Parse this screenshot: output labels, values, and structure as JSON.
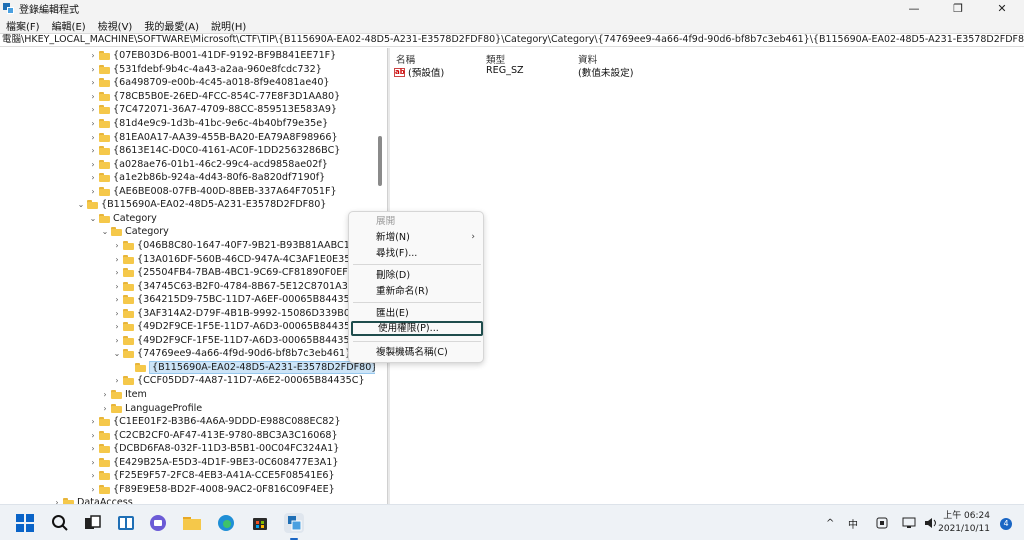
{
  "window": {
    "title": "登錄編輯程式",
    "controls": [
      "—",
      "❐",
      "✕"
    ]
  },
  "menu": [
    "檔案(F)",
    "編輯(E)",
    "檢視(V)",
    "我的最愛(A)",
    "說明(H)"
  ],
  "address": "電腦\\HKEY_LOCAL_MACHINE\\SOFTWARE\\Microsoft\\CTF\\TIP\\{B115690A-EA02-48D5-A231-E3578D2FDF80}\\Category\\Category\\{74769ee9-4a66-4f9d-90d6-bf8b7c3eb461}\\{B115690A-EA02-48D5-A231-E3578D2FDF80}",
  "tree": [
    {
      "label": "{07EB03D6-B001-41DF-9192-BF9B841EE71F}",
      "chev": "›"
    },
    {
      "label": "{531fdebf-9b4c-4a43-a2aa-960e8fcdc732}",
      "chev": "›"
    },
    {
      "label": "{6a498709-e00b-4c45-a018-8f9e4081ae40}",
      "chev": "›"
    },
    {
      "label": "{78CB5B0E-26ED-4FCC-854C-77E8F3D1AA80}",
      "chev": "›"
    },
    {
      "label": "{7C472071-36A7-4709-88CC-859513E583A9}",
      "chev": "›"
    },
    {
      "label": "{81d4e9c9-1d3b-41bc-9e6c-4b40bf79e35e}",
      "chev": "›"
    },
    {
      "label": "{81EA0A17-AA39-455B-BA20-EA79A8F98966}",
      "chev": "›"
    },
    {
      "label": "{8613E14C-D0C0-4161-AC0F-1DD2563286BC}",
      "chev": "›"
    },
    {
      "label": "{a028ae76-01b1-46c2-99c4-acd9858ae02f}",
      "chev": "›"
    },
    {
      "label": "{a1e2b86b-924a-4d43-80f6-8a820df7190f}",
      "chev": "›"
    },
    {
      "label": "{AE6BE008-07FB-400D-8BEB-337A64F7051F}",
      "chev": "›"
    },
    {
      "label": "{B115690A-EA02-48D5-A231-E3578D2FDF80}",
      "chev": "⌄"
    },
    {
      "label": "Category",
      "chev": "⌄"
    },
    {
      "label": "Category",
      "chev": "⌄"
    },
    {
      "label": "{046B8C80-1647-40F7-9B21-B93B81AABC1B}",
      "chev": "›"
    },
    {
      "label": "{13A016DF-560B-46CD-947A-4C3AF1E0E35D}",
      "chev": "›"
    },
    {
      "label": "{25504FB4-7BAB-4BC1-9C69-CF81890F0EF5}",
      "chev": "›"
    },
    {
      "label": "{34745C63-B2F0-4784-8B67-5E12C8701A31}",
      "chev": "›"
    },
    {
      "label": "{364215D9-75BC-11D7-A6EF-00065B84435C}",
      "chev": "›"
    },
    {
      "label": "{3AF314A2-D79F-4B1B-9992-15086D339B05}",
      "chev": "›"
    },
    {
      "label": "{49D2F9CE-1F5E-11D7-A6D3-00065B84435C}",
      "chev": "›"
    },
    {
      "label": "{49D2F9CF-1F5E-11D7-A6D3-00065B84435C}",
      "chev": "›"
    },
    {
      "label": "{74769ee9-4a66-4f9d-90d6-bf8b7c3eb461}",
      "chev": "⌄"
    },
    {
      "label": "{B115690A-EA02-48D5-A231-E3578D2FDF80}",
      "chev": ""
    },
    {
      "label": "{CCF05DD7-4A87-11D7-A6E2-00065B84435C}",
      "chev": "›"
    },
    {
      "label": "Item",
      "chev": "›"
    },
    {
      "label": "LanguageProfile",
      "chev": "›"
    },
    {
      "label": "{C1EE01F2-B3B6-4A6A-9DDD-E988C088EC82}",
      "chev": "›"
    },
    {
      "label": "{C2CB2CF0-AF47-413E-9780-8BC3A3C16068}",
      "chev": "›"
    },
    {
      "label": "{DCBD6FA8-032F-11D3-B5B1-00C04FC324A1}",
      "chev": "›"
    },
    {
      "label": "{E429B25A-E5D3-4D1F-9BE3-0C608477E3A1}",
      "chev": "›"
    },
    {
      "label": "{F25E9F57-2FC8-4EB3-A41A-CCE5F08541E6}",
      "chev": "›"
    },
    {
      "label": "{F89E9E58-BD2F-4008-9AC2-0F816C09F4EE}",
      "chev": "›"
    },
    {
      "label": "DataAccess",
      "chev": "›"
    }
  ],
  "values": {
    "headers": {
      "name": "名稱",
      "type": "類型",
      "data": "資料"
    },
    "rows": [
      {
        "name": "(預設值)",
        "type": "REG_SZ",
        "data": "(數值未設定)",
        "icon": "ab"
      }
    ]
  },
  "context_menu": [
    {
      "label": "展開",
      "disabled": true
    },
    {
      "label": "新增(N)",
      "submenu": true
    },
    {
      "label": "尋找(F)..."
    },
    {
      "label": "刪除(D)"
    },
    {
      "label": "重新命名(R)"
    },
    {
      "label": "匯出(E)"
    },
    {
      "label": "使用權限(P)...",
      "highlight": true
    },
    {
      "label": "複製機碼名稱(C)"
    }
  ],
  "taskbar": {
    "ime": "中",
    "tray_up": "^",
    "time": "上午 06:24",
    "date": "2021/10/11",
    "notifications": "4"
  },
  "colors": {
    "selection": "#cce4f7",
    "folder": "#f5c84a",
    "highlight_border": "#1f4d4d",
    "taskbar": "#eef2f6"
  }
}
